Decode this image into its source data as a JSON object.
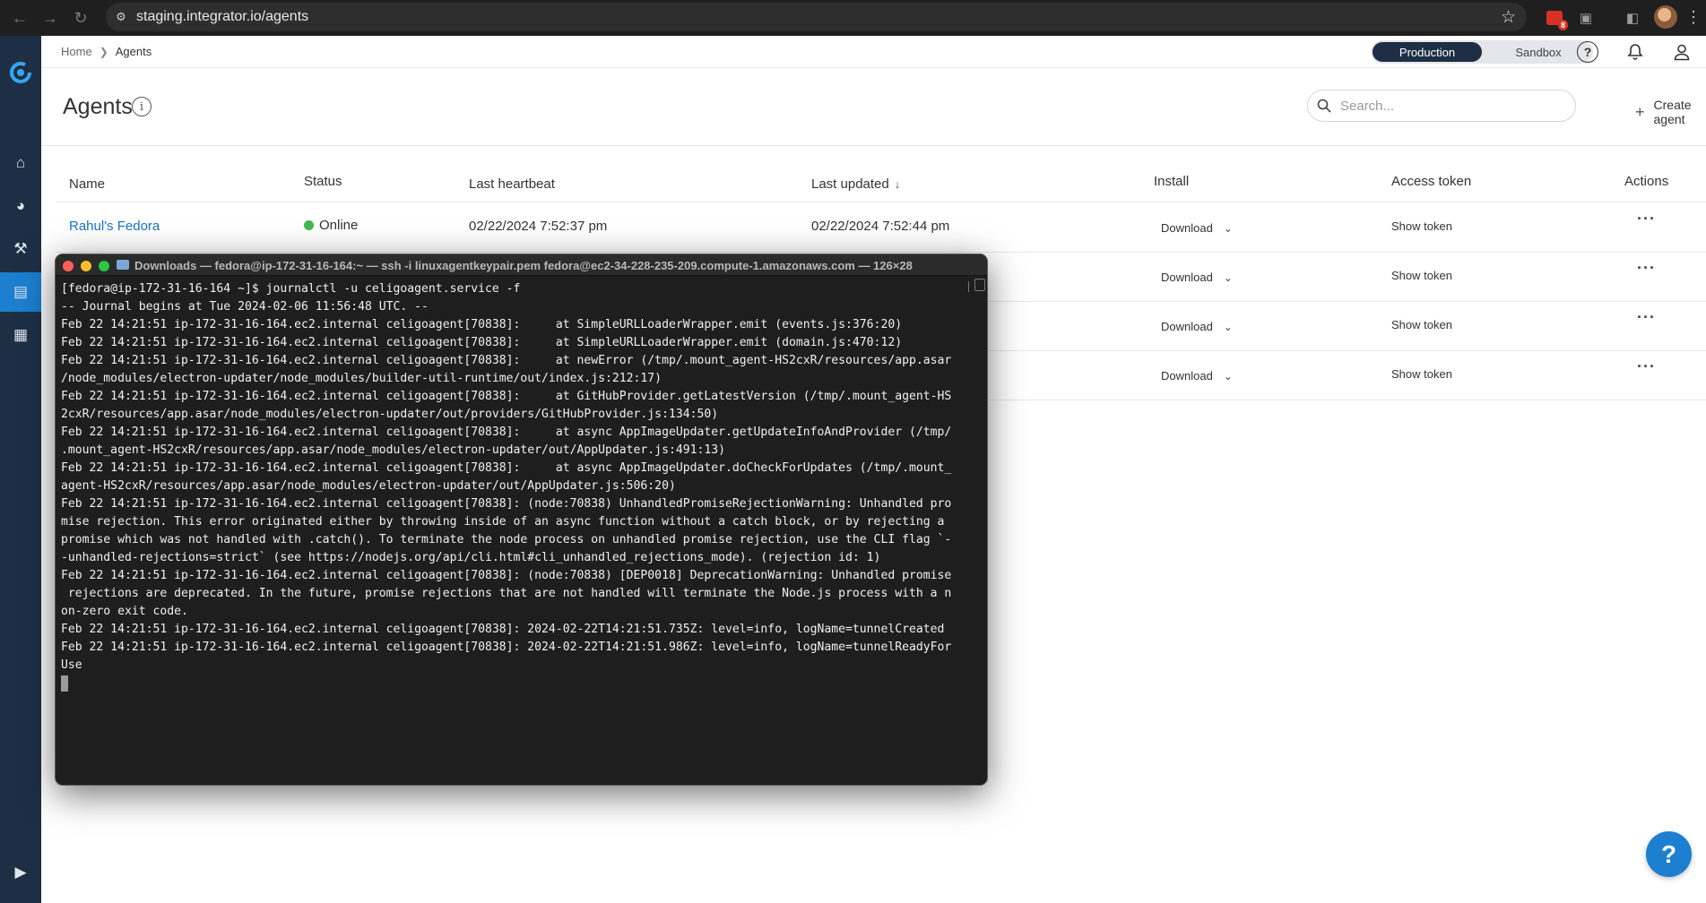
{
  "browser": {
    "url": "staging.integrator.io/agents",
    "extension_badge": "8"
  },
  "breadcrumb": {
    "home": "Home",
    "current": "Agents"
  },
  "environment": {
    "options": [
      "Production",
      "Sandbox"
    ],
    "selected": "Production"
  },
  "page": {
    "title": "Agents",
    "search_placeholder": "Search...",
    "create_label": "Create agent"
  },
  "table": {
    "headers": {
      "name": "Name",
      "status": "Status",
      "last_heartbeat": "Last heartbeat",
      "last_updated": "Last updated",
      "install": "Install",
      "access_token": "Access token",
      "actions": "Actions"
    },
    "sort_column": "Last updated",
    "sort_direction": "descending",
    "rows": [
      {
        "name": "Rahul's Fedora",
        "status": "Online",
        "last_heartbeat": "02/22/2024 7:52:37 pm",
        "last_updated": "02/22/2024 7:52:44 pm",
        "install": "Download",
        "token": "Show token"
      },
      {
        "name": "",
        "status": "",
        "last_heartbeat": "",
        "last_updated": "",
        "install": "Download",
        "token": "Show token"
      },
      {
        "name": "",
        "status": "",
        "last_heartbeat": "",
        "last_updated": "",
        "install": "Download",
        "token": "Show token"
      },
      {
        "name": "",
        "status": "",
        "last_heartbeat": "",
        "last_updated": "",
        "install": "Download",
        "token": "Show token"
      }
    ]
  },
  "terminal": {
    "title": "Downloads — fedora@ip-172-31-16-164:~ — ssh -i linuxagentkeypair.pem fedora@ec2-34-228-235-209.compute-1.amazonaws.com — 126×28",
    "lines": [
      "[fedora@ip-172-31-16-164 ~]$ journalctl -u celigoagent.service -f",
      "-- Journal begins at Tue 2024-02-06 11:56:48 UTC. --",
      "Feb 22 14:21:51 ip-172-31-16-164.ec2.internal celigoagent[70838]:     at SimpleURLLoaderWrapper.emit (events.js:376:20)",
      "Feb 22 14:21:51 ip-172-31-16-164.ec2.internal celigoagent[70838]:     at SimpleURLLoaderWrapper.emit (domain.js:470:12)",
      "Feb 22 14:21:51 ip-172-31-16-164.ec2.internal celigoagent[70838]:     at newError (/tmp/.mount_agent-HS2cxR/resources/app.asar",
      "/node_modules/electron-updater/node_modules/builder-util-runtime/out/index.js:212:17)",
      "Feb 22 14:21:51 ip-172-31-16-164.ec2.internal celigoagent[70838]:     at GitHubProvider.getLatestVersion (/tmp/.mount_agent-HS",
      "2cxR/resources/app.asar/node_modules/electron-updater/out/providers/GitHubProvider.js:134:50)",
      "Feb 22 14:21:51 ip-172-31-16-164.ec2.internal celigoagent[70838]:     at async AppImageUpdater.getUpdateInfoAndProvider (/tmp/",
      ".mount_agent-HS2cxR/resources/app.asar/node_modules/electron-updater/out/AppUpdater.js:491:13)",
      "Feb 22 14:21:51 ip-172-31-16-164.ec2.internal celigoagent[70838]:     at async AppImageUpdater.doCheckForUpdates (/tmp/.mount_",
      "agent-HS2cxR/resources/app.asar/node_modules/electron-updater/out/AppUpdater.js:506:20)",
      "Feb 22 14:21:51 ip-172-31-16-164.ec2.internal celigoagent[70838]: (node:70838) UnhandledPromiseRejectionWarning: Unhandled pro",
      "mise rejection. This error originated either by throwing inside of an async function without a catch block, or by rejecting a",
      "promise which was not handled with .catch(). To terminate the node process on unhandled promise rejection, use the CLI flag `-",
      "-unhandled-rejections=strict` (see https://nodejs.org/api/cli.html#cli_unhandled_rejections_mode). (rejection id: 1)",
      "Feb 22 14:21:51 ip-172-31-16-164.ec2.internal celigoagent[70838]: (node:70838) [DEP0018] DeprecationWarning: Unhandled promise",
      " rejections are deprecated. In the future, promise rejections that are not handled will terminate the Node.js process with a n",
      "on-zero exit code.",
      "Feb 22 14:21:51 ip-172-31-16-164.ec2.internal celigoagent[70838]: 2024-02-22T14:21:51.735Z: level=info, logName=tunnelCreated",
      "Feb 22 14:21:51 ip-172-31-16-164.ec2.internal celigoagent[70838]: 2024-02-22T14:21:51.986Z: level=info, logName=tunnelReadyFor",
      "Use"
    ]
  },
  "help_fab_label": "?",
  "icons": {
    "back": "arrow-left-icon",
    "forward": "arrow-right-icon",
    "reload": "reload-icon",
    "star": "star-icon",
    "help": "help-icon",
    "bell": "bell-icon",
    "user": "user-icon",
    "info": "info-icon",
    "search": "search-icon",
    "plus": "plus-icon"
  },
  "colors": {
    "sidebar": "#1e2f45",
    "accent": "#1c7fd0",
    "online": "#3fb950",
    "link": "#1a73c8"
  }
}
